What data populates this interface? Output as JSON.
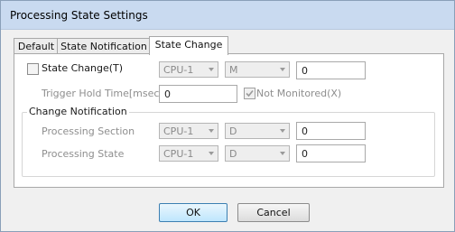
{
  "window": {
    "title": "Processing State Settings"
  },
  "tabs": [
    {
      "label": "Default"
    },
    {
      "label": "State Notification"
    },
    {
      "label": "State Change"
    }
  ],
  "state_change": {
    "label": "State Change(T)",
    "cpu": "CPU-1",
    "device": "M",
    "value": "0"
  },
  "trigger_hold": {
    "label": "Trigger Hold Time[msec]",
    "value": "0",
    "not_monitored_label": "Not Monitored(X)"
  },
  "change_notification": {
    "title": "Change Notification",
    "processing_section": {
      "label": "Processing Section",
      "cpu": "CPU-1",
      "device": "D",
      "value": "0"
    },
    "processing_state": {
      "label": "Processing State",
      "cpu": "CPU-1",
      "device": "D",
      "value": "0"
    }
  },
  "buttons": {
    "ok": "OK",
    "cancel": "Cancel"
  }
}
